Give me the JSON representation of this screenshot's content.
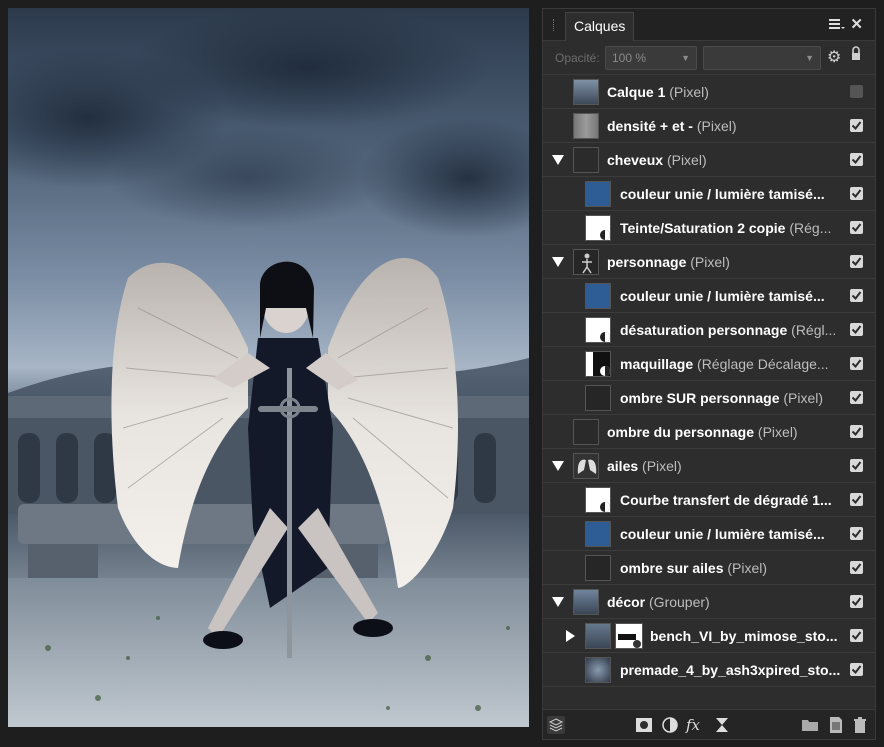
{
  "panel": {
    "tab_label": "Calques",
    "opacity_label": "Opacité:",
    "opacity_value": "100 %",
    "blend_value": ""
  },
  "layers": [
    {
      "name": "Calque 1",
      "kind": "(Pixel)",
      "visible": false
    },
    {
      "name": "densité + et -",
      "kind": "(Pixel)",
      "visible": true
    },
    {
      "name": "cheveux ",
      "kind": "(Pixel)",
      "visible": true
    },
    {
      "name": "couleur unie / lumière tamisé...",
      "kind": "",
      "visible": true
    },
    {
      "name": "Teinte/Saturation 2 copie",
      "kind": "(Rég...",
      "visible": true
    },
    {
      "name": "personnage",
      "kind": "(Pixel)",
      "visible": true
    },
    {
      "name": "couleur unie / lumière tamisé...",
      "kind": "",
      "visible": true
    },
    {
      "name": "désaturation personnage",
      "kind": "(Régl...",
      "visible": true
    },
    {
      "name": "maquillage",
      "kind": "(Réglage Décalage...",
      "visible": true
    },
    {
      "name": "ombre SUR personnage",
      "kind": "(Pixel)",
      "visible": true
    },
    {
      "name": "ombre du personnage",
      "kind": "(Pixel)",
      "visible": true
    },
    {
      "name": "ailes",
      "kind": "(Pixel)",
      "visible": true
    },
    {
      "name": "Courbe transfert de dégradé 1...",
      "kind": "",
      "visible": true
    },
    {
      "name": "couleur unie / lumière tamisé...",
      "kind": "",
      "visible": true
    },
    {
      "name": "ombre sur ailes",
      "kind": "(Pixel)",
      "visible": true
    },
    {
      "name": "décor",
      "kind": "(Grouper)",
      "visible": true
    },
    {
      "name": "bench_VI_by_mimose_sto...",
      "kind": "",
      "visible": true
    },
    {
      "name": "premade_4_by_ash3xpired_sto...",
      "kind": "",
      "visible": true
    }
  ],
  "icons": {
    "menu": "hamburger-menu-icon",
    "close": "close-icon",
    "settings": "gear-icon",
    "lock": "lock-icon",
    "layers": "layers-icon",
    "mask": "mask-icon",
    "adjustment": "adjustment-icon",
    "fx": "fx-icon",
    "live_filter": "hourglass-icon",
    "folder": "folder-icon",
    "new_layer": "new-layer-icon",
    "trash": "trash-icon"
  },
  "colors": {
    "panel_bg": "#2d2d2d",
    "blue_fill": "#2e5c94"
  }
}
